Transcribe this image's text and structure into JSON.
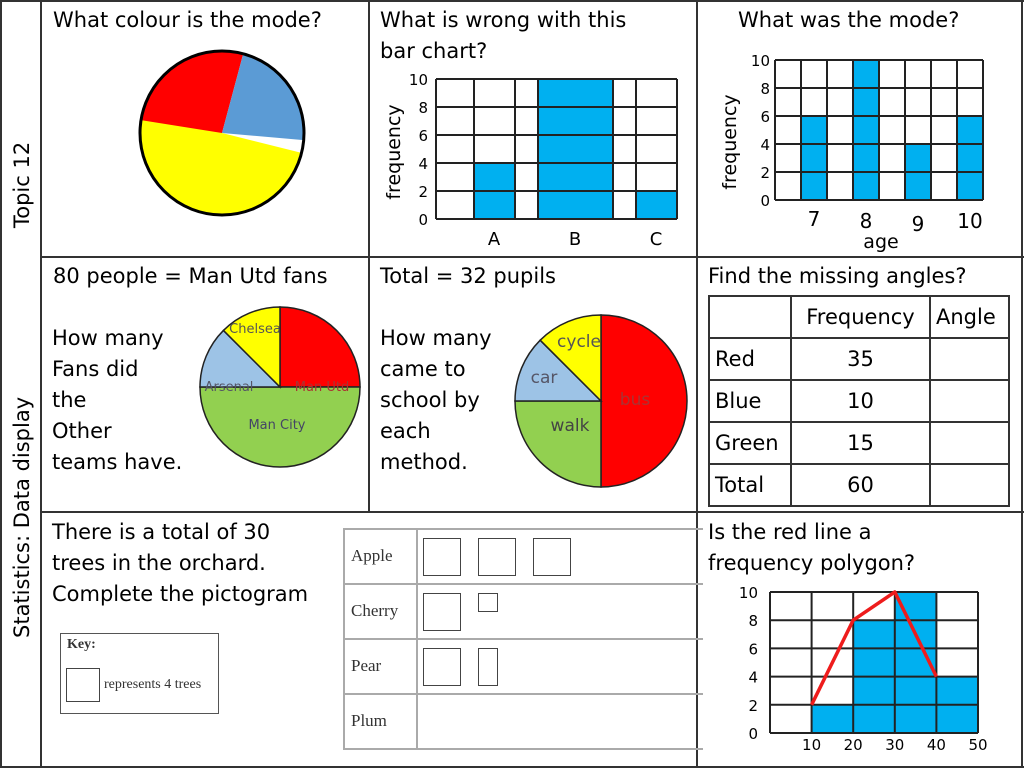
{
  "sidebar": {
    "topic": "Topic 12",
    "subject": "Statistics:  Data display"
  },
  "cells": {
    "mode_colour": {
      "question": "What colour is the mode?",
      "pie": {
        "segments": [
          {
            "name": "red",
            "color": "#ff0000",
            "degrees": 105
          },
          {
            "name": "blue",
            "color": "#5b9bd5",
            "degrees": 80
          },
          {
            "name": "yellow",
            "color": "#ffff00",
            "degrees": 175
          }
        ]
      }
    },
    "wrong_bar": {
      "question_line1": "What is wrong with this",
      "question_line2": "bar chart?",
      "ylabel": "frequency",
      "yticks": [
        "10",
        "8",
        "6",
        "4",
        "2",
        "0"
      ],
      "bars": [
        {
          "label": "A",
          "value": 4
        },
        {
          "label": "B",
          "value": 10
        },
        {
          "label": "C",
          "value": 2
        }
      ]
    },
    "mode_age": {
      "question": "What was the mode?",
      "ylabel": "frequency",
      "xlabel": "age",
      "yticks": [
        "10",
        "8",
        "6",
        "4",
        "2",
        "0"
      ],
      "bars": [
        {
          "label": "7",
          "value": 6
        },
        {
          "label": "8",
          "value": 10
        },
        {
          "label": "9",
          "value": 4
        },
        {
          "label": "10",
          "value": 6
        }
      ]
    },
    "man_utd": {
      "heading": "80 people = Man Utd fans",
      "question_lines": [
        "How many",
        "Fans did",
        "the",
        "Other",
        "teams have."
      ],
      "slices": [
        {
          "label": "Man Utd",
          "color": "#ff0000",
          "degrees": 90
        },
        {
          "label": "Man City",
          "color": "#92d050",
          "degrees": 180
        },
        {
          "label": "Arsenal",
          "color": "#9dc3e6",
          "degrees": 45
        },
        {
          "label": "Chelsea",
          "color": "#ffff00",
          "degrees": 45
        }
      ]
    },
    "pupils": {
      "heading": "Total = 32 pupils",
      "question_lines": [
        "How many",
        "came to",
        "school by",
        "each",
        "method."
      ],
      "slices": [
        {
          "label": "bus",
          "color": "#ff0000",
          "degrees": 180
        },
        {
          "label": "walk",
          "color": "#92d050",
          "degrees": 90
        },
        {
          "label": "car",
          "color": "#9dc3e6",
          "degrees": 45
        },
        {
          "label": "cycle",
          "color": "#ffff00",
          "degrees": 45
        }
      ]
    },
    "angles": {
      "question": "Find the missing angles?",
      "headers": [
        "",
        "Frequency",
        "Angle"
      ],
      "rows": [
        [
          "Red",
          "35",
          ""
        ],
        [
          "Blue",
          "10",
          ""
        ],
        [
          "Green",
          "15",
          ""
        ],
        [
          "Total",
          "60",
          ""
        ]
      ]
    },
    "pictogram": {
      "question_lines": [
        "There is a total of 30",
        "trees in the orchard.",
        "Complete the pictogram"
      ],
      "key_title": "Key:",
      "key_text": "represents 4 trees",
      "rows": [
        {
          "label": "Apple",
          "symbols": [
            1,
            1,
            1
          ]
        },
        {
          "label": "Cherry",
          "symbols": [
            1,
            0.25
          ]
        },
        {
          "label": "Pear",
          "symbols": [
            1,
            0.5
          ]
        },
        {
          "label": "Plum",
          "symbols": []
        }
      ]
    },
    "polygon": {
      "question_line1": "Is the red line a",
      "question_line2": "frequency polygon?",
      "yticks": [
        "10",
        "8",
        "6",
        "4",
        "2",
        "0"
      ],
      "xticks": [
        "10",
        "20",
        "30",
        "40",
        "50"
      ],
      "histogram": [
        {
          "from": 10,
          "to": 20,
          "value": 2
        },
        {
          "from": 20,
          "to": 30,
          "value": 8
        },
        {
          "from": 30,
          "to": 40,
          "value": 10
        },
        {
          "from": 40,
          "to": 50,
          "value": 4
        }
      ],
      "line_points": [
        [
          10,
          2
        ],
        [
          20,
          8
        ],
        [
          30,
          10
        ],
        [
          40,
          4
        ]
      ],
      "line_color": "#ee1c1c"
    }
  },
  "chart_data": [
    {
      "type": "pie",
      "title": "What colour is the mode?",
      "categories": [
        "red",
        "blue",
        "yellow"
      ],
      "values": [
        105,
        80,
        175
      ]
    },
    {
      "type": "bar",
      "title": "What is wrong with this bar chart?",
      "categories": [
        "A",
        "B",
        "C"
      ],
      "values": [
        4,
        10,
        2
      ],
      "xlabel": "",
      "ylabel": "frequency",
      "ylim": [
        0,
        10
      ]
    },
    {
      "type": "bar",
      "title": "What was the mode?",
      "categories": [
        "7",
        "8",
        "9",
        "10"
      ],
      "values": [
        6,
        10,
        4,
        6
      ],
      "xlabel": "age",
      "ylabel": "frequency",
      "ylim": [
        0,
        10
      ]
    },
    {
      "type": "pie",
      "title": "80 people = Man Utd fans",
      "categories": [
        "Man Utd",
        "Man City",
        "Arsenal",
        "Chelsea"
      ],
      "values": [
        90,
        180,
        45,
        45
      ]
    },
    {
      "type": "pie",
      "title": "Total = 32 pupils",
      "categories": [
        "bus",
        "walk",
        "car",
        "cycle"
      ],
      "values": [
        180,
        90,
        45,
        45
      ]
    },
    {
      "type": "bar",
      "title": "Is the red line a frequency polygon?",
      "categories": [
        "10-20",
        "20-30",
        "30-40",
        "40-50"
      ],
      "values": [
        2,
        8,
        10,
        4
      ],
      "series": [
        {
          "name": "histogram",
          "values": [
            2,
            8,
            10,
            4
          ]
        },
        {
          "name": "red line",
          "x": [
            10,
            20,
            30,
            40
          ],
          "values": [
            2,
            8,
            10,
            4
          ]
        }
      ],
      "xlim": [
        0,
        50
      ],
      "ylim": [
        0,
        10
      ]
    }
  ]
}
